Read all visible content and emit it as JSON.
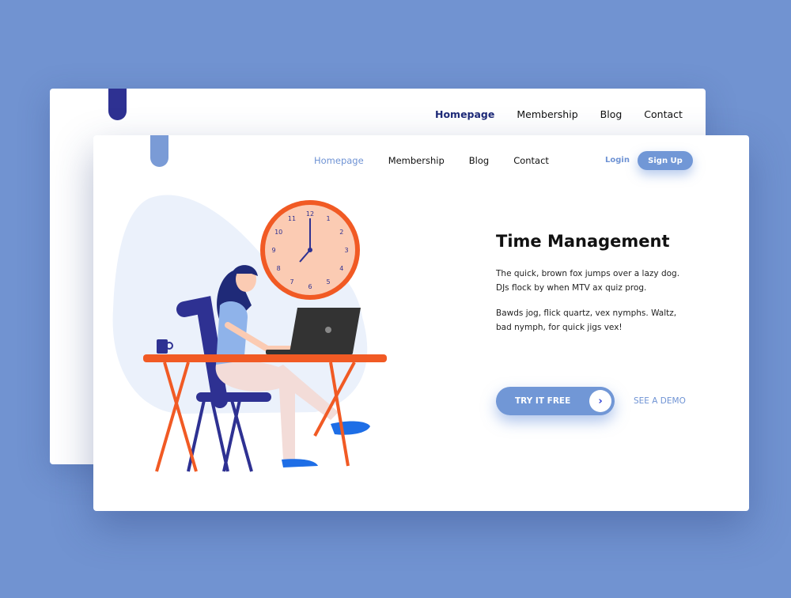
{
  "colors": {
    "background": "#7193d1",
    "accent": "#7197d6",
    "back_tab": "#2e3192",
    "front_tab": "#7a9bd6",
    "clock": "#f15a24"
  },
  "back_card": {
    "nav": [
      {
        "label": "Homepage",
        "active": true
      },
      {
        "label": "Membership"
      },
      {
        "label": "Blog"
      },
      {
        "label": "Contact"
      }
    ]
  },
  "front_card": {
    "nav": [
      {
        "label": "Homepage",
        "active": true
      },
      {
        "label": "Membership"
      },
      {
        "label": "Blog"
      },
      {
        "label": "Contact"
      }
    ],
    "login": "Login",
    "signup": "Sign Up",
    "hero": {
      "title": "Time Management",
      "paragraph1_line1": "The quick, brown fox jumps over a lazy dog.",
      "paragraph1_line2": "DJs flock by when MTV ax quiz prog.",
      "paragraph2_line1": "Bawds jog, flick quartz, vex nymphs. Waltz,",
      "paragraph2_line2": "bad nymph, for quick jigs vex!",
      "cta": "TRY IT FREE",
      "cta_icon": "chevron-right-icon",
      "secondary": "SEE A DEMO"
    },
    "clock_numbers": [
      "12",
      "1",
      "2",
      "3",
      "4",
      "5",
      "6",
      "7",
      "8",
      "9",
      "10",
      "11"
    ]
  }
}
